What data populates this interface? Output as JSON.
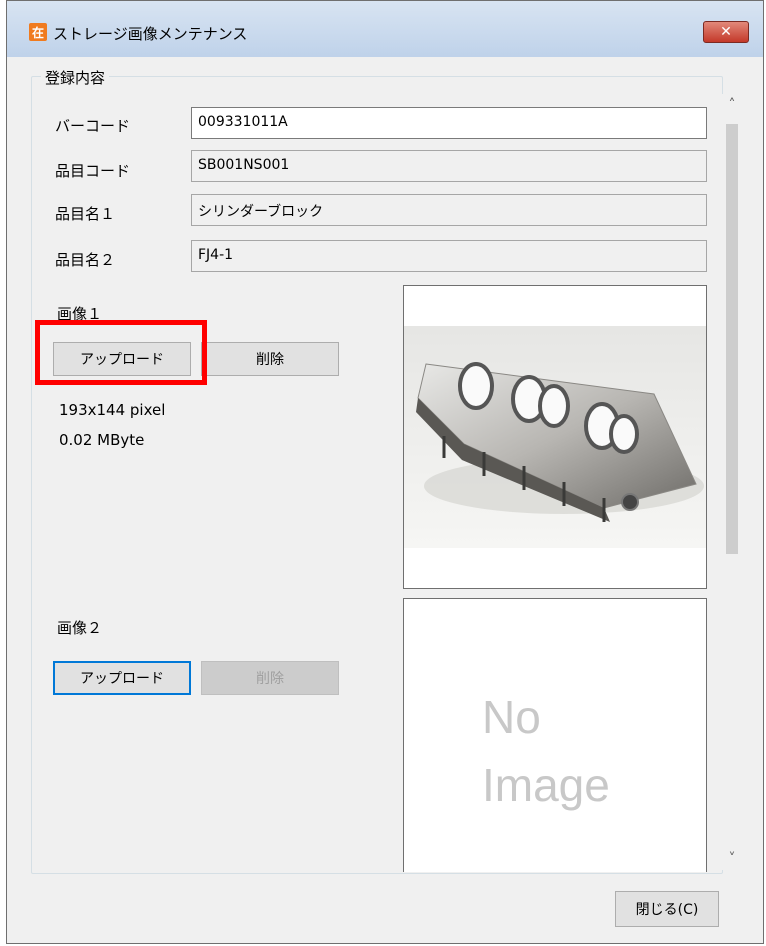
{
  "window": {
    "title": "ストレージ画像メンテナンス",
    "app_icon": "在",
    "close_glyph": "✕"
  },
  "group": {
    "title": "登録内容"
  },
  "fields": {
    "barcode": {
      "label": "バーコード",
      "value": "009331011A"
    },
    "item_code": {
      "label": "品目コード",
      "value": "SB001NS001"
    },
    "item_name1": {
      "label": "品目名１",
      "value": "シリンダーブロック"
    },
    "item_name2": {
      "label": "品目名２",
      "value": "FJ4-1"
    }
  },
  "image1": {
    "label": "画像１",
    "upload_label": "アップロード",
    "delete_label": "削除",
    "dimensions": "193x144 pixel",
    "size": "0.02 MByte"
  },
  "image2": {
    "label": "画像２",
    "upload_label": "アップロード",
    "delete_label": "削除",
    "no_image_line1": "No",
    "no_image_line2": "Image"
  },
  "footer": {
    "close_label": "閉じる(C)"
  },
  "scroll": {
    "up_glyph": "˄",
    "down_glyph": "˅"
  },
  "colors": {
    "highlight": "#ff0000",
    "focus": "#0078d7"
  }
}
